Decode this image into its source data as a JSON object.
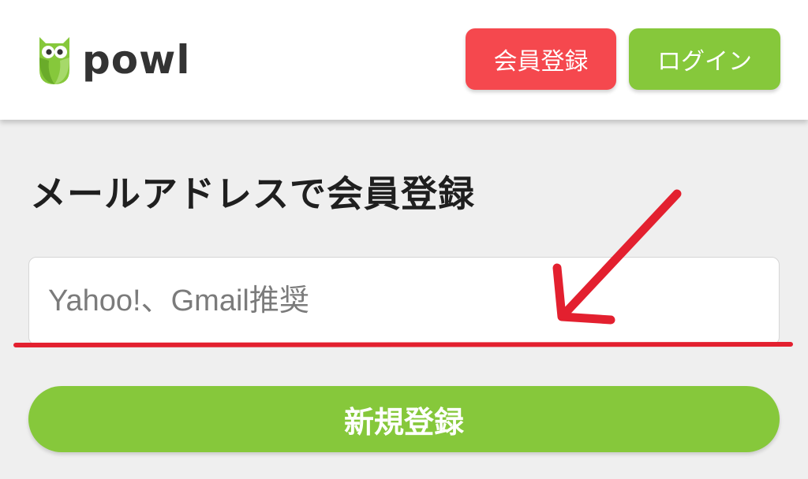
{
  "header": {
    "logo_text": "powl",
    "signup_label": "会員登録",
    "login_label": "ログイン"
  },
  "main": {
    "title": "メールアドレスで会員登録",
    "email_placeholder": "Yahoo!、Gmail推奨",
    "submit_label": "新規登録"
  },
  "colors": {
    "signup": "#f5484e",
    "green": "#86c83b",
    "annotation": "#e3202f"
  },
  "icons": [
    "owl-logo-icon",
    "annotation-arrow",
    "annotation-underline"
  ]
}
